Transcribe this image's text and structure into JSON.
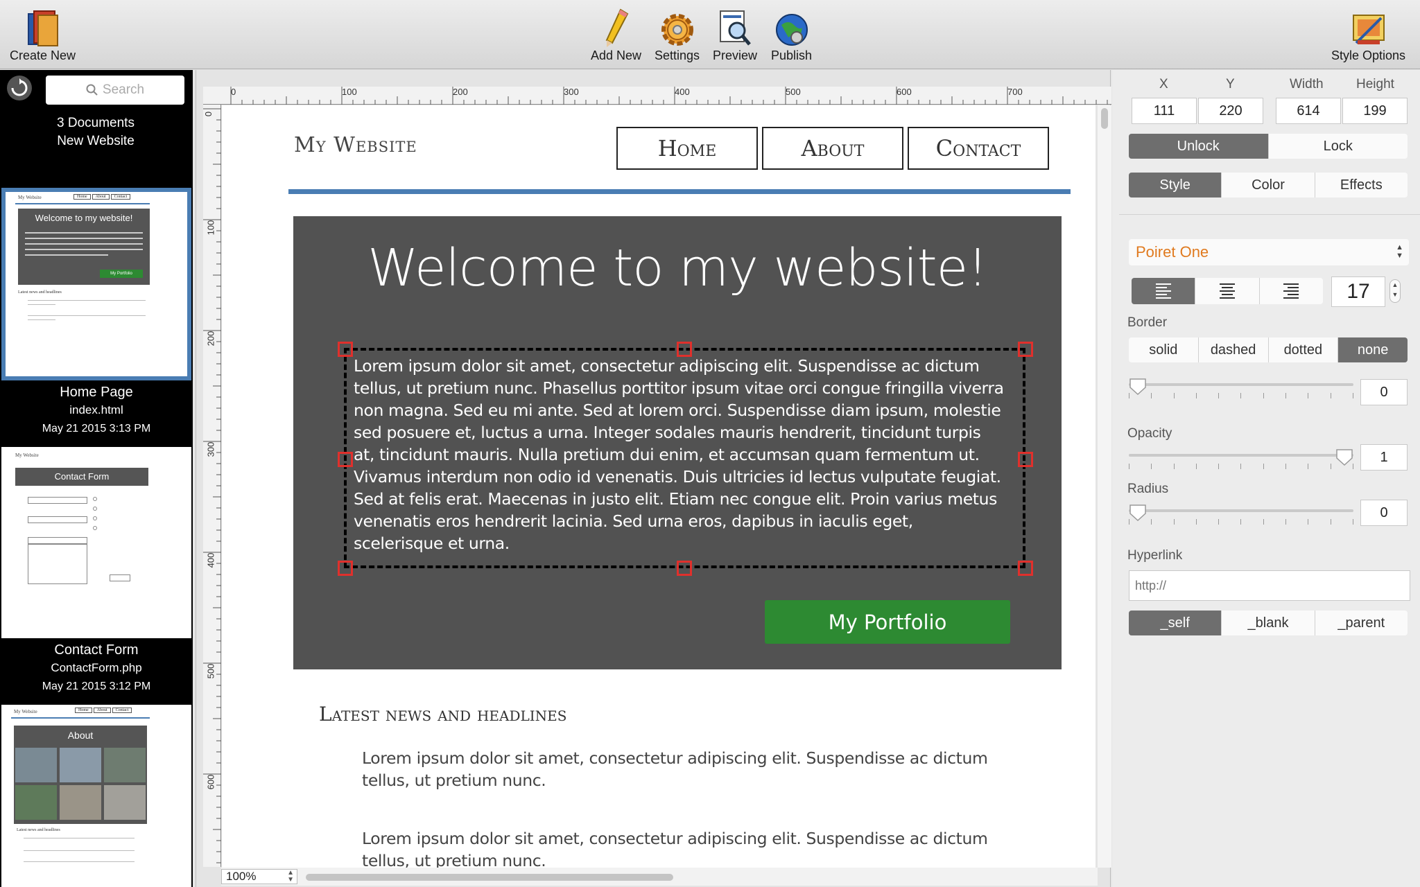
{
  "toolbar": {
    "create_new": "Create New",
    "add_new": "Add New",
    "settings": "Settings",
    "preview": "Preview",
    "publish": "Publish",
    "style_options": "Style Options"
  },
  "sidebar": {
    "search_placeholder": "Search",
    "doc_count": "3 Documents",
    "project_name": "New Website",
    "documents": [
      {
        "title": "Home Page",
        "file": "index.html",
        "date": "May 21 2015 3:13 PM"
      },
      {
        "title": "Contact Form",
        "file": "ContactForm.php",
        "date": "May 21 2015 3:12 PM"
      },
      {
        "title": "About"
      }
    ],
    "thumb_home": {
      "site": "My Website",
      "nav": [
        "Home",
        "About",
        "Contact"
      ],
      "hero": "Welcome to my website!",
      "button": "My Portfolio",
      "news": "Latest news and headlines"
    },
    "thumb_contact": {
      "site": "My Website",
      "hero": "Contact Form"
    },
    "thumb_about": {
      "site": "My Website",
      "nav": [
        "Home",
        "About",
        "Contact"
      ],
      "hero": "About",
      "news": "Latest news and headlines"
    }
  },
  "canvas": {
    "zoom": "100%",
    "ruler_top": [
      "0",
      "100",
      "200",
      "300",
      "400",
      "500",
      "600",
      "700"
    ],
    "ruler_left": [
      "0",
      "100",
      "200",
      "300",
      "400",
      "500",
      "600"
    ],
    "site_title": "My Website",
    "nav": [
      "Home",
      "About",
      "Contact"
    ],
    "hero_title": "Welcome to my website!",
    "hero_body": "Lorem ipsum dolor sit amet, consectetur adipiscing elit. Suspendisse ac dictum tellus, ut pretium nunc. Phasellus porttitor ipsum vitae orci congue fringilla viverra non magna. Sed eu mi ante. Sed at lorem orci. Suspendisse diam ipsum, molestie sed posuere et, luctus a urna. Integer sodales mauris hendrerit, tincidunt turpis at, tincidunt mauris. Nulla pretium dui enim, et accumsan quam fermentum ut. Vivamus interdum non odio id venenatis. Duis ultricies id lectus vulputate feugiat. Sed at felis erat. Maecenas in justo elit. Etiam nec congue elit. Proin varius metus venenatis eros hendrerit lacinia. Sed urna eros, dapibus in iaculis eget, scelerisque et urna.",
    "button": "My Portfolio",
    "news_heading": "Latest news and headlines",
    "news_items": [
      "Lorem ipsum dolor sit amet, consectetur adipiscing elit. Suspendisse ac dictum tellus, ut pretium nunc.",
      "Lorem ipsum dolor sit amet, consectetur adipiscing elit. Suspendisse ac dictum tellus, ut pretium nunc."
    ]
  },
  "inspector": {
    "labels": {
      "x": "X",
      "y": "Y",
      "width": "Width",
      "height": "Height",
      "border": "Border",
      "opacity": "Opacity",
      "radius": "Radius",
      "hyperlink": "Hyperlink"
    },
    "x": "111",
    "y": "220",
    "width": "614",
    "height": "199",
    "lock_options": [
      "Unlock",
      "Lock"
    ],
    "lock_selected": "Unlock",
    "tabs": [
      "Style",
      "Color",
      "Effects"
    ],
    "tab_selected": "Style",
    "font": "Poiret One",
    "font_size": "17",
    "border_options": [
      "solid",
      "dashed",
      "dotted",
      "none"
    ],
    "border_selected": "none",
    "border_width": "0",
    "border_width_level": 0,
    "opacity": "1",
    "opacity_level": 1,
    "radius": "0",
    "radius_level": 0,
    "hyperlink_placeholder": "http://",
    "targets": [
      "_self",
      "_blank",
      "_parent"
    ],
    "target_selected": "_self",
    "colors": {
      "font": "#e07a1f",
      "selected_segment": "#6e6e6e"
    }
  }
}
